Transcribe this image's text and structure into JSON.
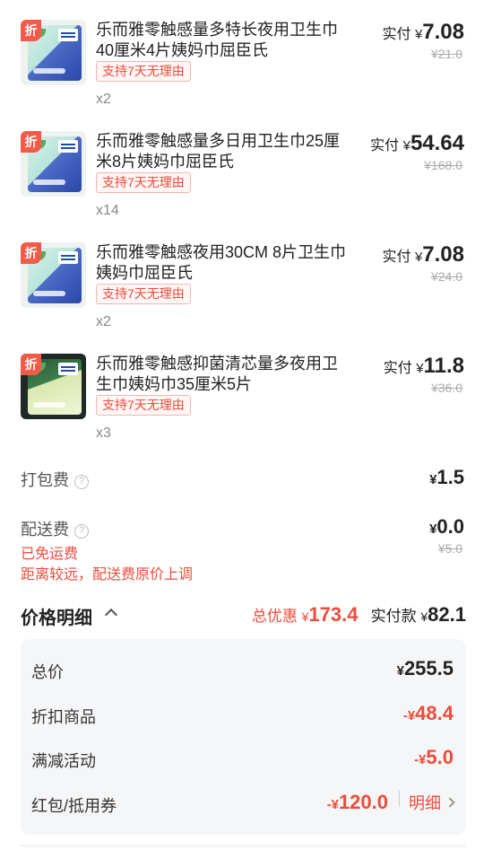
{
  "items": [
    {
      "discount_tag": "折",
      "title": "乐而雅零触感量多特长夜用卫生巾40厘米4片姨妈巾屈臣氏",
      "refund_badge": "支持7天无理由",
      "quantity": "x2",
      "paid_label": "实付",
      "currency": "¥",
      "paid_amount": "7.08",
      "original_price": "¥21.0"
    },
    {
      "discount_tag": "折",
      "title": "乐而雅零触感量多日用卫生巾25厘米8片姨妈巾屈臣氏",
      "refund_badge": "支持7天无理由",
      "quantity": "x14",
      "paid_label": "实付",
      "currency": "¥",
      "paid_amount": "54.64",
      "original_price": "¥168.0"
    },
    {
      "discount_tag": "折",
      "title": "乐而雅零触感夜用30CM 8片卫生巾姨妈巾屈臣氏",
      "refund_badge": "支持7天无理由",
      "quantity": "x2",
      "paid_label": "实付",
      "currency": "¥",
      "paid_amount": "7.08",
      "original_price": "¥24.0"
    },
    {
      "discount_tag": "折",
      "title": "乐而雅零触感抑菌清芯量多夜用卫生巾姨妈巾35厘米5片",
      "refund_badge": "支持7天无理由",
      "quantity": "x3",
      "paid_label": "实付",
      "currency": "¥",
      "paid_amount": "11.8",
      "original_price": "¥36.0"
    }
  ],
  "packing_fee": {
    "label": "打包费",
    "currency": "¥",
    "amount": "1.5"
  },
  "delivery_fee": {
    "label": "配送费",
    "currency": "¥",
    "amount": "0.0",
    "original": "¥5.0",
    "note1": "已免运费",
    "note2": "距离较远，配送费原价上调"
  },
  "price_detail": {
    "title": "价格明细",
    "total_discount_label": "总优惠",
    "total_discount_currency": "¥",
    "total_discount": "173.4",
    "paid_label": "实付款",
    "paid_currency": "¥",
    "paid": "82.1",
    "rows": [
      {
        "label": "总价",
        "currency": "¥",
        "value": "255.5"
      },
      {
        "label": "折扣商品",
        "currency": "-¥",
        "value": "48.4"
      },
      {
        "label": "满减活动",
        "currency": "-¥",
        "value": "5.0"
      },
      {
        "label": "红包/抵用券",
        "currency": "-¥",
        "value": "120.0",
        "link": "明细"
      }
    ]
  },
  "colors": {
    "accent_red": "#ef4b3c",
    "discount_tag_bg": "#f25a4a",
    "panel_bg": "#f5f6f8"
  }
}
